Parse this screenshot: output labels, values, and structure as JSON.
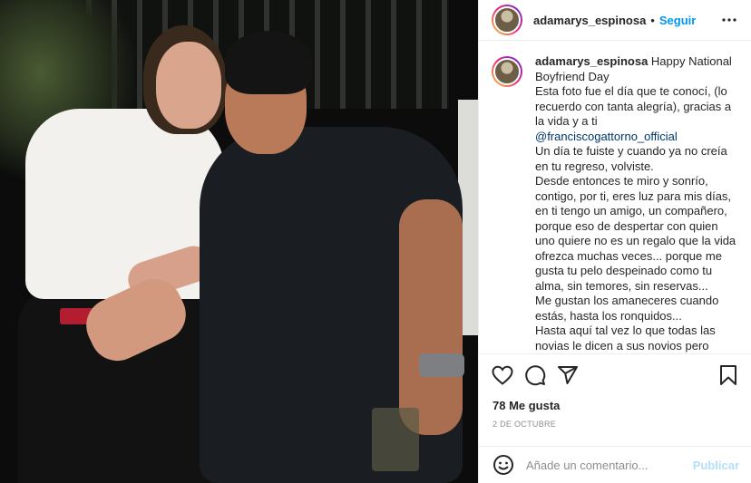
{
  "post": {
    "image_alt": "Foto de pareja sonriendo"
  },
  "header": {
    "username": "adamarys_espinosa",
    "separator": "•",
    "follow_label": "Seguir",
    "more_icon": "more-horizontal-icon"
  },
  "caption": {
    "username": "adamarys_espinosa",
    "first_line": "Happy National Boyfriend Day",
    "line2_before_mention": "Esta foto fue el día que te conocí, (lo recuerdo con tanta alegría), gracias a la vida y a ti ",
    "mention": "@franciscogattorno_official",
    "line3": "Un día te fuiste y cuando ya no creía en tu regreso, volviste.",
    "line4": "Desde entonces te miro y sonrío, contigo, por ti, eres luz para mis días, en ti tengo un amigo, un compañero, porque eso de despertar con quien uno quiere no es un regalo que la vida ofrezca muchas veces... porque me gusta tu pelo despeinado como tu alma, sin temores, sin reservas...",
    "line5": "Me gustan los amaneceres cuando estás, hasta los ronquidos...",
    "line6": "Hasta aquí tal vez lo que todas las novias le dicen a sus novios pero ahora, lo que te digo yo a ti:"
  },
  "actions": {
    "like_icon": "heart-icon",
    "comment_icon": "comment-icon",
    "share_icon": "share-icon",
    "save_icon": "bookmark-icon"
  },
  "likes_text": "78 Me gusta",
  "date_text": "2 DE OCTUBRE",
  "comment": {
    "emoji_icon": "emoji-icon",
    "placeholder": "Añade un comentario...",
    "publish_label": "Publicar",
    "publish_color": "#b2dffc"
  },
  "colors": {
    "link_blue": "#0095f6",
    "mention_blue": "#00376b"
  }
}
